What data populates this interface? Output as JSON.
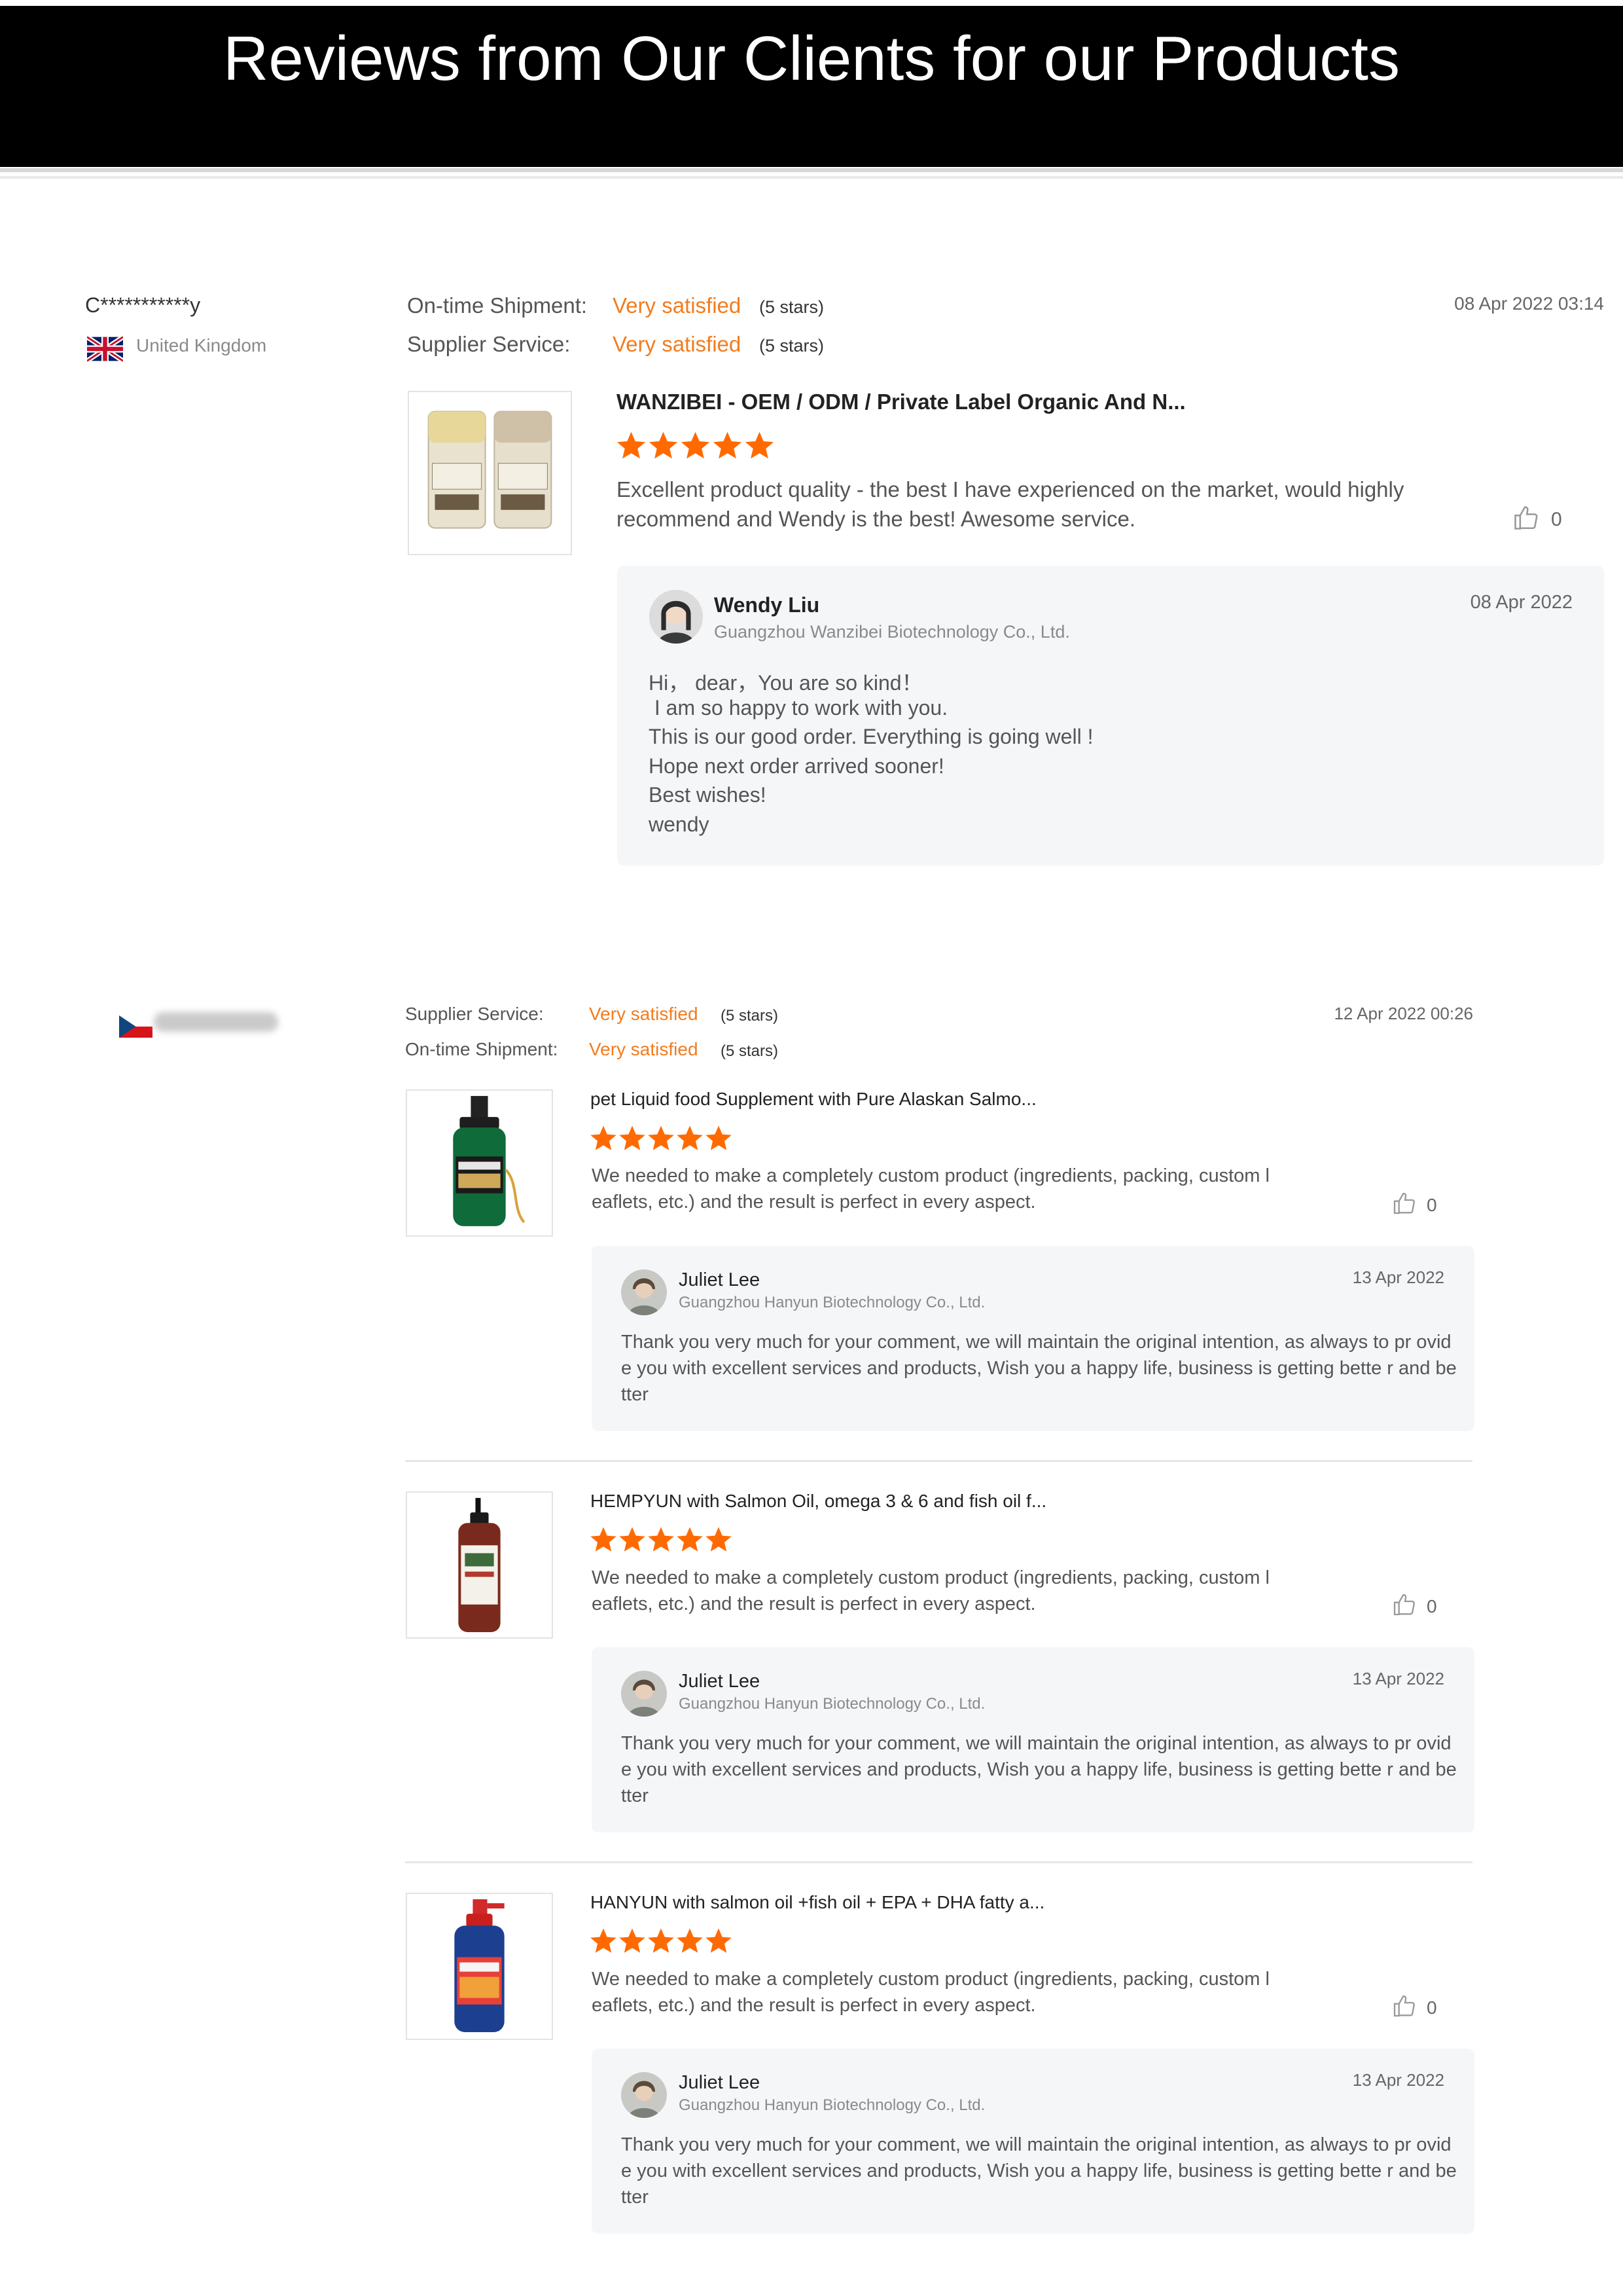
{
  "header": {
    "title": "Reviews from Our Clients for our Products"
  },
  "colors": {
    "accent": "#f27c1e",
    "star": "#ff6a00",
    "reply_bg": "#f5f6f8"
  },
  "review1": {
    "user": "C***********y",
    "country": "United Kingdom",
    "flag_icon": "uk-flag-icon",
    "date": "08 Apr 2022 03:14",
    "ratings": [
      {
        "label": "On-time Shipment:",
        "value": "Very satisfied",
        "stars_note": "(5 stars)"
      },
      {
        "label": "Supplier Service:",
        "value": "Very satisfied",
        "stars_note": "(5 stars)"
      }
    ],
    "product": {
      "title": "WANZIBEI - OEM / ODM / Private Label Organic And N...",
      "rating": 5,
      "comment": "Excellent product quality - the best I have experienced on the market, would highly recommend and Wendy is the best! Awesome service.",
      "likes": "0"
    },
    "reply": {
      "name": "Wendy Liu",
      "company": "Guangzhou Wanzibei Biotechnology Co., Ltd.",
      "date": "08 Apr 2022",
      "lines": [
        "Hi， dear，You are so kind！",
        " I am so happy to work with you.",
        "This is our good order. Everything is going well !",
        "Hope next order arrived sooner!",
        "Best wishes!",
        "wendy"
      ]
    }
  },
  "review2": {
    "flag_icon": "czech-flag-icon",
    "date": "12 Apr 2022 00:26",
    "ratings": [
      {
        "label": "Supplier Service:",
        "value": "Very satisfied",
        "stars_note": "(5 stars)"
      },
      {
        "label": "On-time Shipment:",
        "value": "Very satisfied",
        "stars_note": "(5 stars)"
      }
    ],
    "products": [
      {
        "title": "pet Liquid food Supplement with Pure Alaskan Salmo...",
        "rating": 5,
        "comment": "We needed to make a completely custom product (ingredients, packing, custom l eaflets, etc.) and the result is perfect in every aspect.",
        "likes": "0",
        "reply": {
          "name": "Juliet Lee",
          "company": "Guangzhou Hanyun Biotechnology Co., Ltd.",
          "date": "13 Apr 2022",
          "text": "Thank you very much for your comment, we will maintain the original intention, as always to pr ovide you with excellent services and products, Wish you a happy life, business is getting bette r and better"
        }
      },
      {
        "title": "HEMPYUN with Salmon Oil, omega 3 & 6 and fish oil f...",
        "rating": 5,
        "comment": "We needed to make a completely custom product (ingredients, packing, custom l eaflets, etc.) and the result is perfect in every aspect.",
        "likes": "0",
        "reply": {
          "name": "Juliet Lee",
          "company": "Guangzhou Hanyun Biotechnology Co., Ltd.",
          "date": "13 Apr 2022",
          "text": "Thank you very much for your comment, we will maintain the original intention, as always to pr ovide you with excellent services and products, Wish you a happy life, business is getting bette r and better"
        }
      },
      {
        "title": "HANYUN with salmon oil +fish oil + EPA + DHA fatty a...",
        "rating": 5,
        "comment": "We needed to make a completely custom product (ingredients, packing, custom l eaflets, etc.) and the result is perfect in every aspect.",
        "likes": "0",
        "reply": {
          "name": "Juliet Lee",
          "company": "Guangzhou Hanyun Biotechnology Co., Ltd.",
          "date": "13 Apr 2022",
          "text": "Thank you very much for your comment, we will maintain the original intention, as always to pr ovide you with excellent services and products, Wish you a happy life, business is getting bette r and better"
        }
      }
    ]
  }
}
